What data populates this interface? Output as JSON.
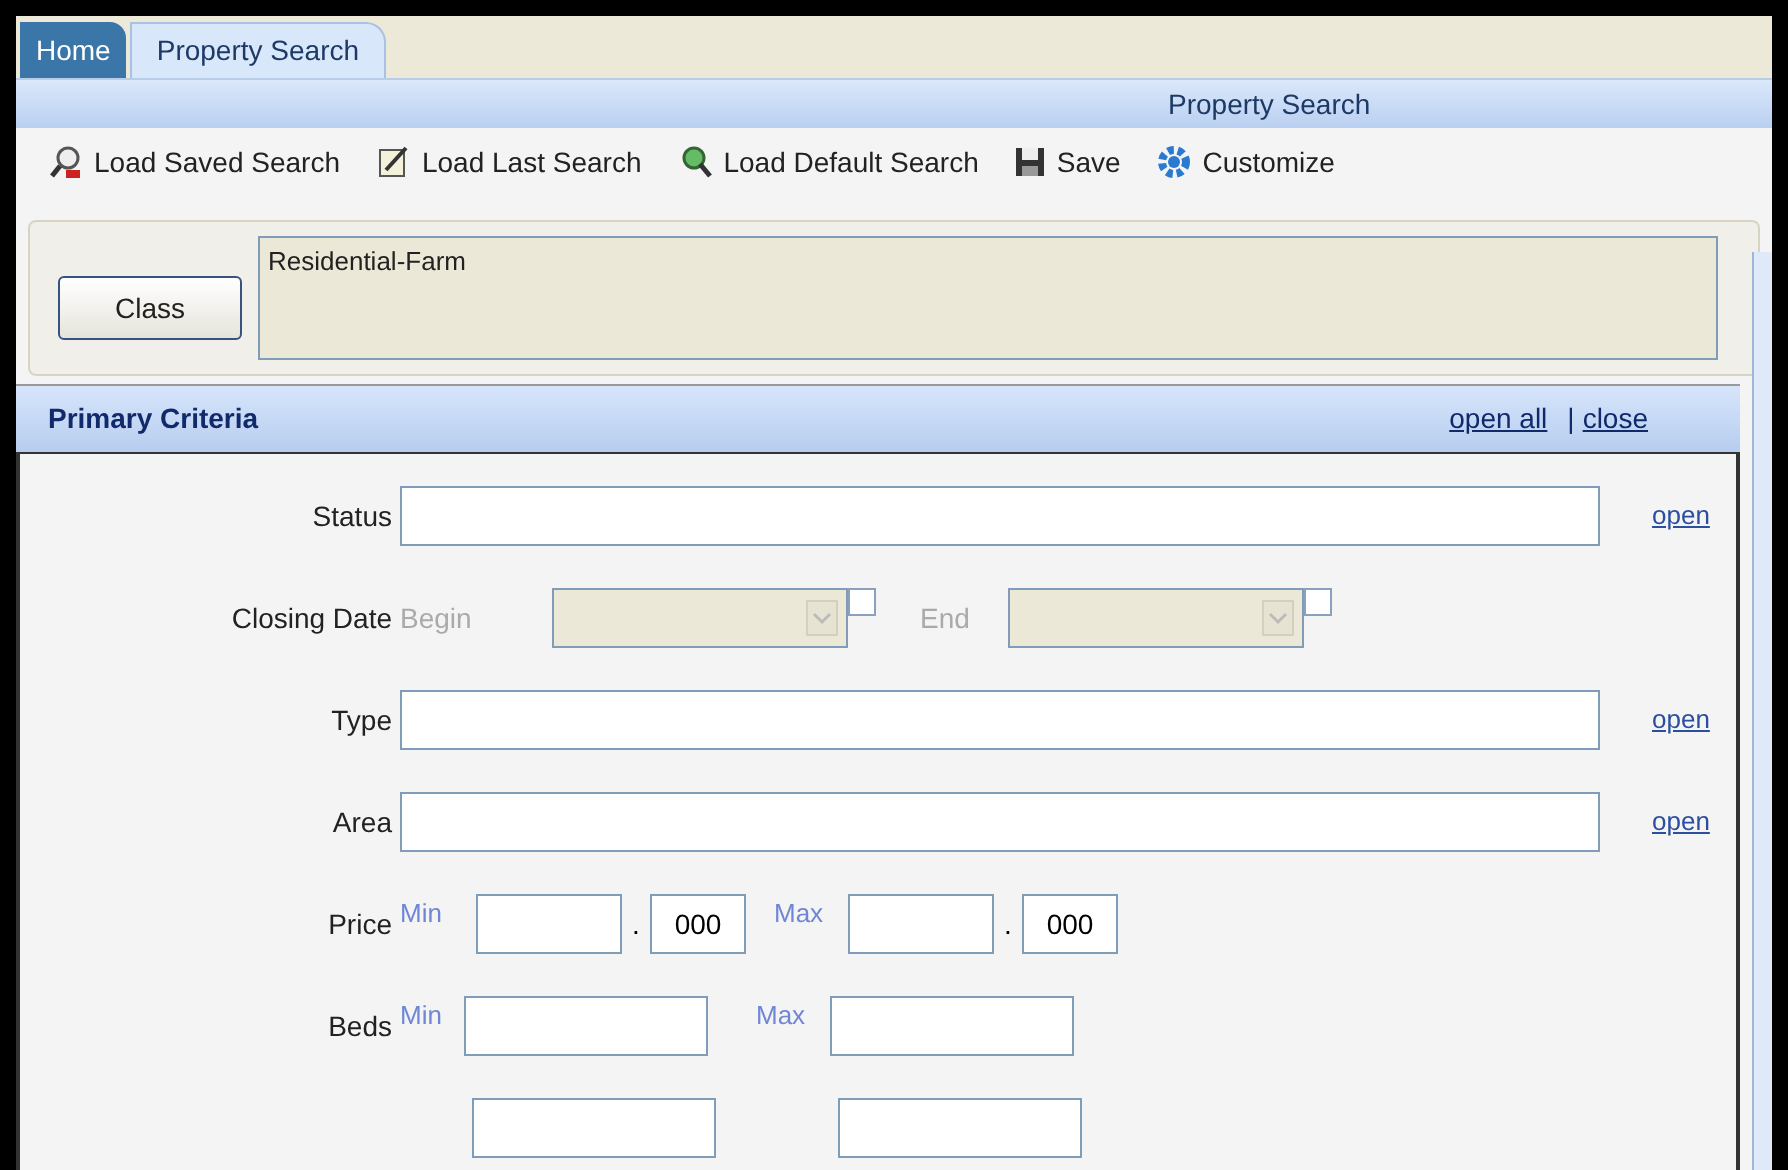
{
  "tabs": [
    {
      "label": "Home",
      "selected": false
    },
    {
      "label": "Property Search",
      "selected": true
    }
  ],
  "header": {
    "title": "Property Search"
  },
  "toolbar": [
    {
      "label": "Load Saved Search",
      "kind": "saved"
    },
    {
      "label": "Load Last Search",
      "kind": "last"
    },
    {
      "label": "Load Default Search",
      "kind": "default"
    },
    {
      "label": "Save",
      "kind": "save"
    },
    {
      "label": "Customize",
      "kind": "customize"
    }
  ],
  "class_panel": {
    "button": "Class",
    "value": "Residential-Farm"
  },
  "section": {
    "title": "Primary Criteria",
    "open_all": "open all",
    "separator": "|",
    "close": "close"
  },
  "fields": [
    {
      "kind": "text",
      "label": "Status",
      "link": "open"
    },
    {
      "kind": "date",
      "label": "Closing Date",
      "begin": "Begin",
      "end": "End",
      "begin_checked": false,
      "end_checked": false
    },
    {
      "kind": "text",
      "label": "Type",
      "link": "open"
    },
    {
      "kind": "text",
      "label": "Area",
      "link": "open"
    },
    {
      "kind": "price",
      "label": "Price",
      "min": "Min",
      "max": "Max",
      "dot": ".",
      "min_suffix": "000",
      "max_suffix": "000"
    },
    {
      "kind": "range",
      "label": "Beds",
      "min": "Min",
      "max": "Max"
    },
    {
      "kind": "partial"
    }
  ]
}
